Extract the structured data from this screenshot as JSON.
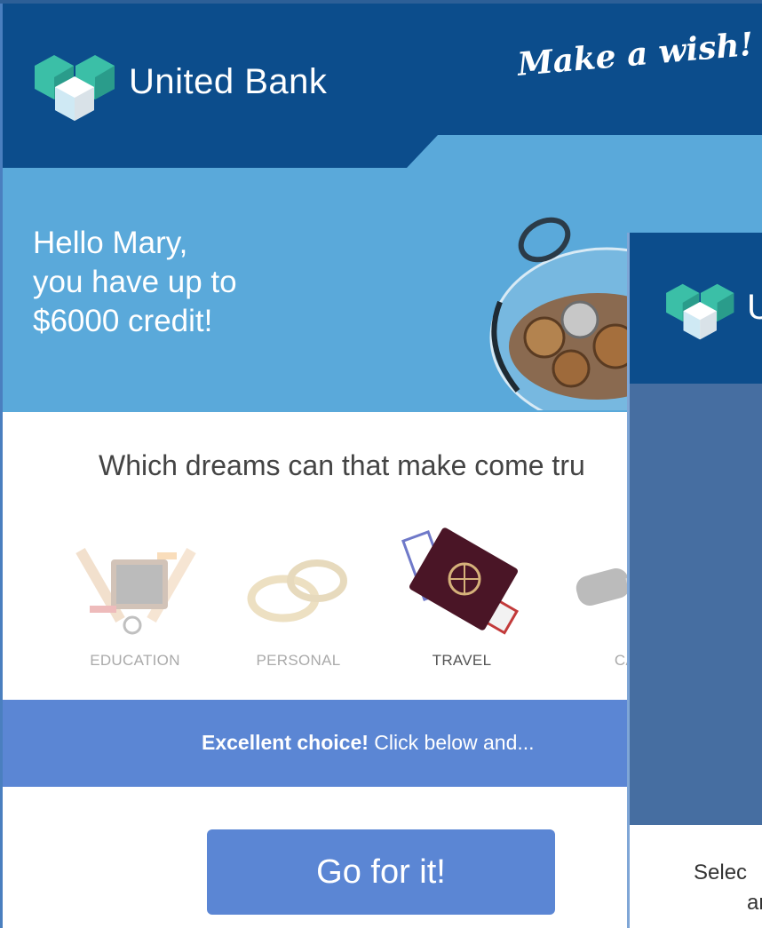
{
  "header": {
    "brand": "United Bank",
    "slogan": "Make a wish!",
    "greeting_lines": [
      "Hello Mary,",
      "you have up to",
      "$6000 credit!"
    ]
  },
  "question": "Which dreams can that make come tru",
  "categories": [
    {
      "label": "EDUCATION",
      "icon": "education-icon",
      "state": "faded"
    },
    {
      "label": "PERSONAL",
      "icon": "rings-icon",
      "state": "faded"
    },
    {
      "label": "TRAVEL",
      "icon": "passport-icon",
      "state": "selected"
    },
    {
      "label": "CA",
      "icon": "car-key-icon",
      "state": "faded"
    }
  ],
  "choice": {
    "bold": "Excellent choice!",
    "rest": " Click below and..."
  },
  "button": {
    "label": "Go for it!"
  },
  "second_card": {
    "brand": "U",
    "select_line1": "Selec",
    "select_line2": "ar"
  },
  "colors": {
    "dark_blue": "#0c4d8c",
    "sky_blue": "#5aa9da",
    "accent": "#5b86d4",
    "overlay_body": "#466ea1",
    "logo_teal": "#3bbfa7"
  }
}
